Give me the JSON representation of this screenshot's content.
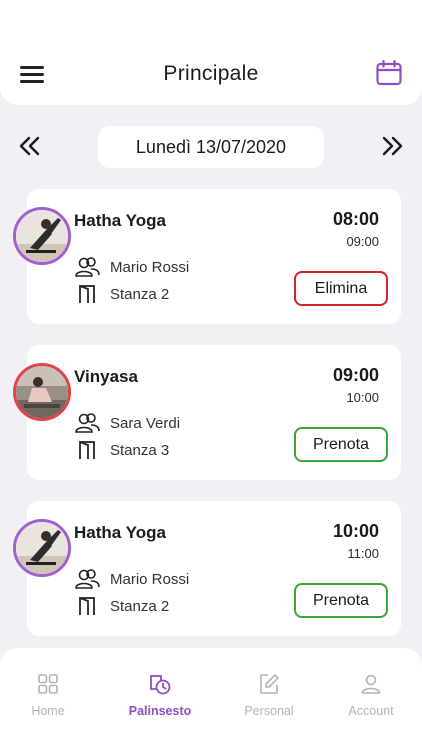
{
  "header": {
    "title": "Principale",
    "menu_icon": "hamburger-menu-icon",
    "calendar_icon": "calendar-icon",
    "accent": "#8e4fc2"
  },
  "date_nav": {
    "prev_icon": "double-chevron-left-icon",
    "next_icon": "double-chevron-right-icon",
    "date": "Lunedì 13/07/2020"
  },
  "classes": [
    {
      "name": "Hatha Yoga",
      "start": "08:00",
      "end": "09:00",
      "instructor": "Mario Rossi",
      "room": "Stanza 2",
      "action": "Elimina",
      "action_color": "#d2212a",
      "avatar_ring": "#a25fd0"
    },
    {
      "name": "Vinyasa",
      "start": "09:00",
      "end": "10:00",
      "instructor": "Sara Verdi",
      "room": "Stanza 3",
      "action": "Prenota",
      "action_color": "#3aa63a",
      "avatar_ring": "#e0434c"
    },
    {
      "name": "Hatha Yoga",
      "start": "10:00",
      "end": "11:00",
      "instructor": "Mario Rossi",
      "room": "Stanza 2",
      "action": "Prenota",
      "action_color": "#3aa63a",
      "avatar_ring": "#a25fd0"
    }
  ],
  "tabs": [
    {
      "label": "Home",
      "icon": "grid-icon",
      "active": false
    },
    {
      "label": "Palinsesto",
      "icon": "schedule-icon",
      "active": true
    },
    {
      "label": "Personal",
      "icon": "edit-icon",
      "active": false
    },
    {
      "label": "Account",
      "icon": "user-icon",
      "active": false
    }
  ]
}
